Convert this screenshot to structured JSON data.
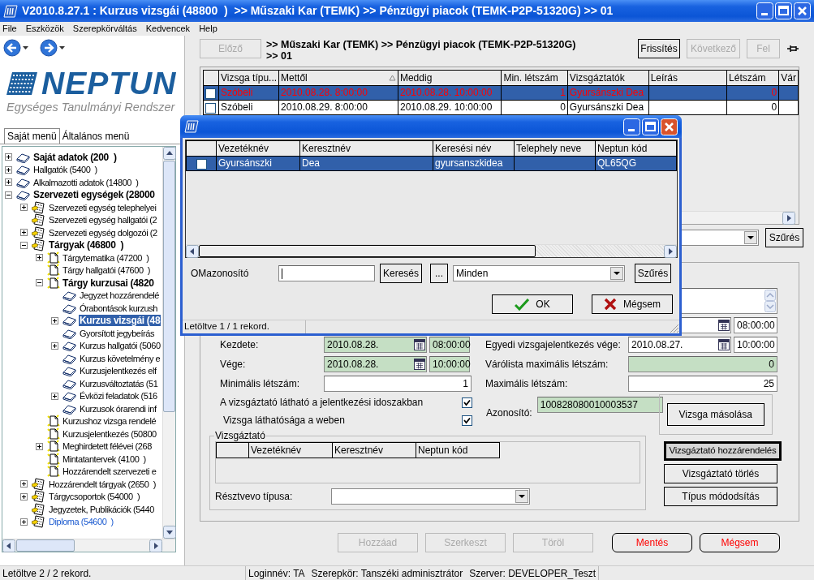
{
  "window": {
    "title": "V2010.8.27.1 : Kurzus vizsgái (48800  )  >> Műszaki Kar (TEMK) >> Pénzügyi piacok (TEMK-P2P-51320G) >> 01"
  },
  "menu": [
    "File",
    "Eszközök",
    "Szerepkörváltás",
    "Kedvencek",
    "Help"
  ],
  "logo": {
    "name": "NEPTUN",
    "subtitle": "Egységes Tanulmányi Rendszer"
  },
  "menu_tabs": [
    {
      "label": "Saját menü",
      "selected": true
    },
    {
      "label": "Általános menü",
      "selected": false
    }
  ],
  "tree": [
    {
      "label": "Saját adatok (200  )",
      "kind": "book",
      "bold": true,
      "highlighted": false,
      "selected": false,
      "expanded": false
    },
    {
      "label": "Hallgatók (5400  )",
      "kind": "book",
      "bold": false,
      "highlighted": false,
      "selected": false,
      "expanded": false
    },
    {
      "label": "Alkalmazotti adatok (14800  )",
      "kind": "book",
      "bold": false,
      "highlighted": false,
      "selected": false,
      "expanded": false
    },
    {
      "label": "Szervezeti egységek (28000",
      "kind": "book",
      "bold": true,
      "highlighted": false,
      "selected": false,
      "expanded": true,
      "children": [
        {
          "label": "Szervezeti egység telephelyei",
          "kind": "module",
          "bold": false,
          "highlighted": false,
          "selected": false,
          "expanded": false
        },
        {
          "label": "Szervezeti egység hallgatói (2",
          "kind": "module",
          "bold": false,
          "highlighted": false,
          "selected": false
        },
        {
          "label": "Szervezeti egység dolgozói (2",
          "kind": "module",
          "bold": false,
          "highlighted": false,
          "selected": false,
          "expanded": false
        },
        {
          "label": "Tárgyak (46800  )",
          "kind": "module",
          "bold": true,
          "highlighted": false,
          "selected": false,
          "expanded": true,
          "children": [
            {
              "label": "Tárgytematika (47200  )",
              "kind": "page",
              "bold": false,
              "highlighted": false,
              "selected": false,
              "expanded": false
            },
            {
              "label": "Tárgy hallgatói (47600  )",
              "kind": "page",
              "bold": false,
              "highlighted": false,
              "selected": false
            },
            {
              "label": "Tárgy kurzusai (4820",
              "kind": "page",
              "bold": true,
              "highlighted": false,
              "selected": false,
              "expanded": true,
              "children": [
                {
                  "label": "Jegyzet hozzárendelé",
                  "kind": "book",
                  "bold": false,
                  "highlighted": false,
                  "selected": false
                },
                {
                  "label": "Órabontások kurzush",
                  "kind": "book",
                  "bold": false,
                  "highlighted": false,
                  "selected": false
                },
                {
                  "label": "Kurzus vizsgái (48",
                  "kind": "book",
                  "bold": true,
                  "highlighted": false,
                  "selected": true,
                  "expanded": false
                },
                {
                  "label": "Gyorsított jegybeírás",
                  "kind": "book",
                  "bold": false,
                  "highlighted": false,
                  "selected": false
                },
                {
                  "label": "Kurzus hallgatói (5060",
                  "kind": "book",
                  "bold": false,
                  "highlighted": false,
                  "selected": false,
                  "expanded": false
                },
                {
                  "label": "Kurzus követelmény e",
                  "kind": "book",
                  "bold": false,
                  "highlighted": false,
                  "selected": false
                },
                {
                  "label": "Kurzusjelentkezés elf",
                  "kind": "book",
                  "bold": false,
                  "highlighted": false,
                  "selected": false
                },
                {
                  "label": "Kurzusváltoztatás (51",
                  "kind": "book",
                  "bold": false,
                  "highlighted": false,
                  "selected": false
                },
                {
                  "label": "Évközi feladatok (516",
                  "kind": "book",
                  "bold": false,
                  "highlighted": false,
                  "selected": false,
                  "expanded": false
                },
                {
                  "label": "Kurzusok órarendi inf",
                  "kind": "book",
                  "bold": false,
                  "highlighted": false,
                  "selected": false
                }
              ]
            },
            {
              "label": "Kurzushoz vizsga rendelé",
              "kind": "page",
              "bold": false,
              "highlighted": false,
              "selected": false
            },
            {
              "label": "Kurzusjelentkezés (50800",
              "kind": "page",
              "bold": false,
              "highlighted": false,
              "selected": false
            },
            {
              "label": "Meghirdetett félévei (268",
              "kind": "page",
              "bold": false,
              "highlighted": false,
              "selected": false,
              "expanded": false
            },
            {
              "label": "Mintatantervek (4100  )",
              "kind": "page",
              "bold": false,
              "highlighted": false,
              "selected": false
            },
            {
              "label": "Hozzárendelt szervezeti e",
              "kind": "page",
              "bold": false,
              "highlighted": false,
              "selected": false
            }
          ]
        },
        {
          "label": "Hozzárendelt tárgyak (2650  )",
          "kind": "module",
          "bold": false,
          "highlighted": false,
          "selected": false,
          "expanded": false
        },
        {
          "label": "Tárgycsoportok (54000  )",
          "kind": "module",
          "bold": false,
          "highlighted": false,
          "selected": false,
          "expanded": false
        },
        {
          "label": "Jegyzetek, Publikációk (5440",
          "kind": "module",
          "bold": false,
          "highlighted": false,
          "selected": false
        },
        {
          "label": "Diploma (54600  )",
          "kind": "module",
          "bold": false,
          "highlighted": true,
          "selected": false,
          "expanded": false
        }
      ]
    }
  ],
  "left_status": "Letöltve 2 / 2 rekord.",
  "toolbar": {
    "back": {
      "label": "Előző",
      "disabled": true
    },
    "breadcrumb": [
      ">> Műszaki Kar (TEMK) >> Pénzügyi piacok (TEMK-P2P-51320G)",
      ">> 01"
    ],
    "buttons": [
      {
        "label": "Frissítés",
        "disabled": false
      },
      {
        "label": "Következő",
        "disabled": true
      },
      {
        "label": "Fel",
        "disabled": true
      }
    ]
  },
  "exam_table": {
    "columns": [
      {
        "label": "Vizsga típu...",
        "sorted": false
      },
      {
        "label": "Mettől",
        "sorted": true
      },
      {
        "label": "Meddig",
        "sorted": false
      },
      {
        "label": "Min. létszám",
        "sorted": false
      },
      {
        "label": "Vizsgáztatók",
        "sorted": false
      },
      {
        "label": "Leírás",
        "sorted": false
      },
      {
        "label": "Létszám",
        "sorted": false
      },
      {
        "label": "Vár",
        "sorted": false
      }
    ],
    "rows": [
      {
        "selected": true,
        "checked": false,
        "type": "Szóbeli",
        "from": "2010.08.28. 8:00:00",
        "until": "2010.08.28. 10:00:00",
        "min_count": "1",
        "examiners": "Gyursánszki Dea",
        "count": "0"
      },
      {
        "selected": false,
        "checked": false,
        "type": "Szóbeli",
        "from": "2010.08.29. 8:00:00",
        "until": "2010.08.29. 10:00:00",
        "min_count": "0",
        "examiners": "Gyursánszki Dea",
        "count": "0"
      }
    ]
  },
  "filter_button": "Szűrés",
  "exam_form": {
    "registration_start": {
      "time": "08:00:00"
    },
    "start": {
      "label": "Kezdete:",
      "date": "2010.08.28.",
      "time": "08:00:00",
      "readonly": true
    },
    "end": {
      "label": "Vége:",
      "date": "2010.08.28.",
      "time": "10:00:00",
      "readonly": true
    },
    "min_count": {
      "label": "Minimális létszám:",
      "value": "1",
      "readonly": false
    },
    "examiner_visible": {
      "label": "A vizsgáztató látható a jelentkezési idoszakban",
      "checked": true
    },
    "web_visible": {
      "label": "Vizsga láthatósága a weben",
      "checked": true
    },
    "registration_end": {
      "label": "Egyedi vizsgajelentkezés vége:",
      "date": "2010.08.27.",
      "time": "10:00:00",
      "readonly": false
    },
    "waitlist_max": {
      "label": "Várólista maximális létszám:",
      "value": "0",
      "readonly": true
    },
    "max_count": {
      "label": "Maximális létszám:",
      "value": "25",
      "readonly": false
    },
    "identifier": {
      "label": "Azonosító:",
      "value": "100828080010003537",
      "readonly": true
    },
    "copy_button": "Vizsga másolása"
  },
  "examiners": {
    "title": "Vizsgáztató",
    "columns": [
      "Vezetéknév",
      "Keresztnév",
      "Neptun kód"
    ],
    "participant_label": "Résztvevo típusa:",
    "buttons": [
      {
        "label": "Vizsgáztató hozzárendelés",
        "focused": true
      },
      {
        "label": "Vizsgáztató törlés",
        "focused": false
      },
      {
        "label": "Típus módodsítás",
        "focused": false
      }
    ]
  },
  "actions": [
    {
      "label": "Hozzáad",
      "disabled": true,
      "alert": false
    },
    {
      "label": "Szerkeszt",
      "disabled": true,
      "alert": false
    },
    {
      "label": "Töröl",
      "disabled": true,
      "alert": false
    },
    {
      "label": "Mentés",
      "disabled": false,
      "alert": true
    },
    {
      "label": "Mégsem",
      "disabled": false,
      "alert": true
    }
  ],
  "status_bar": [
    "Loginnév: TA",
    "Szerepkör: Tanszéki adminisztrátor",
    "Szerver: DEVELOPER_Teszt"
  ],
  "dialog": {
    "columns": [
      "Vezetéknév",
      "Keresztnév",
      "Keresési név",
      "Telephely neve",
      "Neptun kód"
    ],
    "rows": [
      {
        "selected": true,
        "checked": false,
        "last_name": "Gyursánszki",
        "first_name": "Dea",
        "search_name": "gyursanszkidea",
        "neptun_code": "QL65QG"
      }
    ],
    "filter": {
      "label": "OMazonosító",
      "search_button": "Keresés",
      "more_button": "...",
      "scope": "Minden",
      "filter_button": "Szűrés"
    },
    "ok": "OK",
    "cancel": "Mégsem",
    "status": "Letöltve 1 / 1 rekord."
  }
}
